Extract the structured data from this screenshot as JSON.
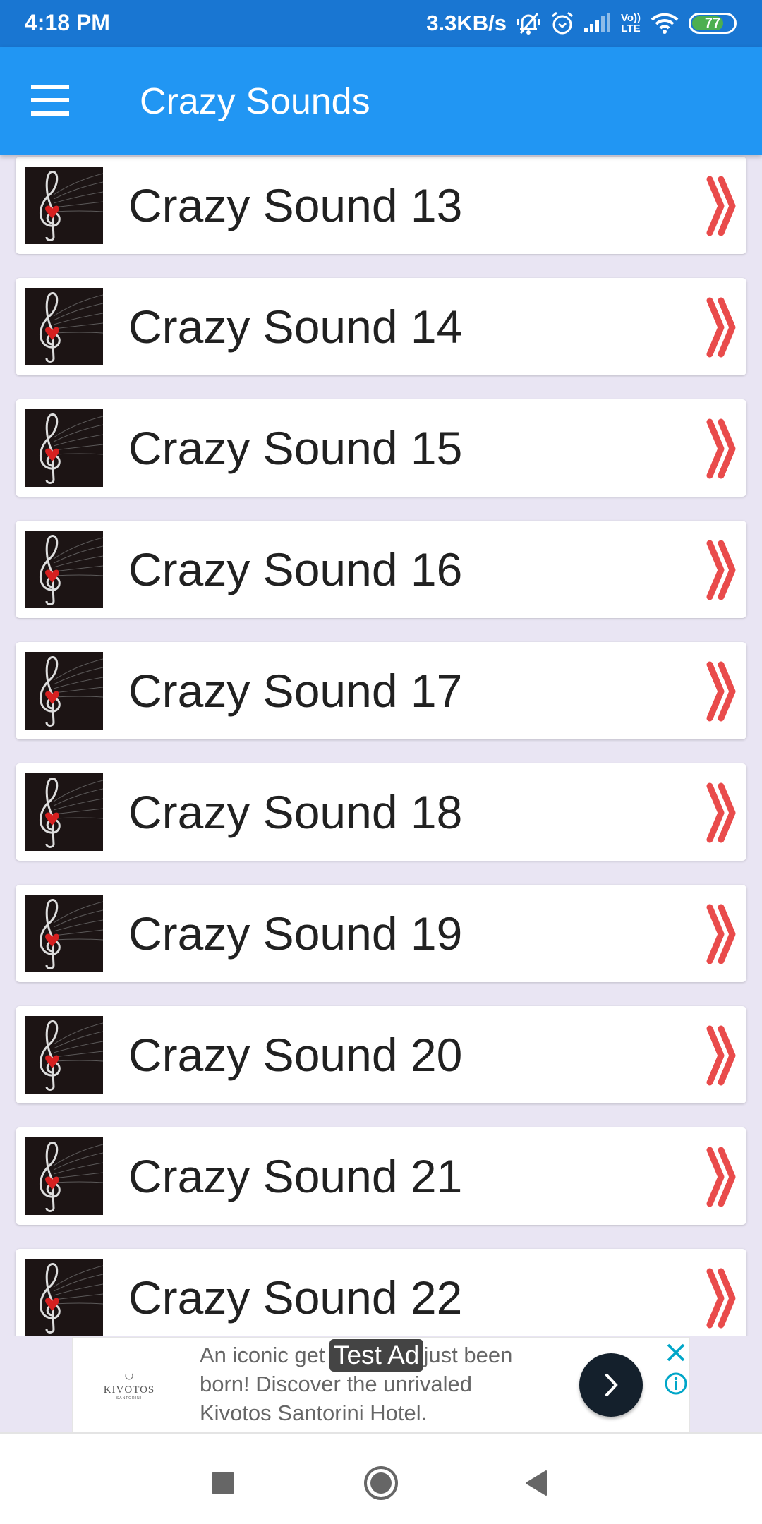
{
  "status_bar": {
    "time": "4:18 PM",
    "net_speed": "3.3KB/s",
    "icons": [
      "bell-muted-icon",
      "alarm-icon",
      "signal-icon",
      "volte-icon",
      "wifi-icon",
      "battery-icon"
    ],
    "volte_top": "Vo))",
    "volte_bottom": "LTE",
    "battery_level": "77",
    "battery_percent": 77,
    "battery_color": "#4CAF50"
  },
  "app_bar": {
    "title": "Crazy Sounds",
    "menu_icon": "hamburger-menu-icon",
    "color": "#2196F3"
  },
  "list": {
    "item_icon": "treble-clef-heart-thumbnail",
    "chevron_icon": "double-chevron-right-icon",
    "chevron_color": "#E94B4B",
    "items": [
      {
        "label": "Crazy Sound 13"
      },
      {
        "label": "Crazy Sound 14"
      },
      {
        "label": "Crazy Sound 15"
      },
      {
        "label": "Crazy Sound 16"
      },
      {
        "label": "Crazy Sound 17"
      },
      {
        "label": "Crazy Sound 18"
      },
      {
        "label": "Crazy Sound 19"
      },
      {
        "label": "Crazy Sound 20"
      },
      {
        "label": "Crazy Sound 21"
      },
      {
        "label": "Crazy Sound 22"
      }
    ]
  },
  "ad": {
    "badge": "Test Ad",
    "logo_name": "KIVOTOS",
    "logo_sub": "SANTORINI",
    "text": "An iconic getaway has just been born! Discover the unrivaled Kivotos Santorini Hotel.",
    "text_lines": [
      "An iconic get",
      "just been",
      "born! Discover the unrivaled",
      "Kivotos Santorini Hotel."
    ],
    "cta_icon": "chevron-right-icon",
    "close_icon": "close-icon",
    "info_icon": "info-icon",
    "accent": "#00A6C8"
  },
  "nav_bar": {
    "buttons": [
      "recents-square-icon",
      "home-circle-icon",
      "back-triangle-icon"
    ]
  }
}
